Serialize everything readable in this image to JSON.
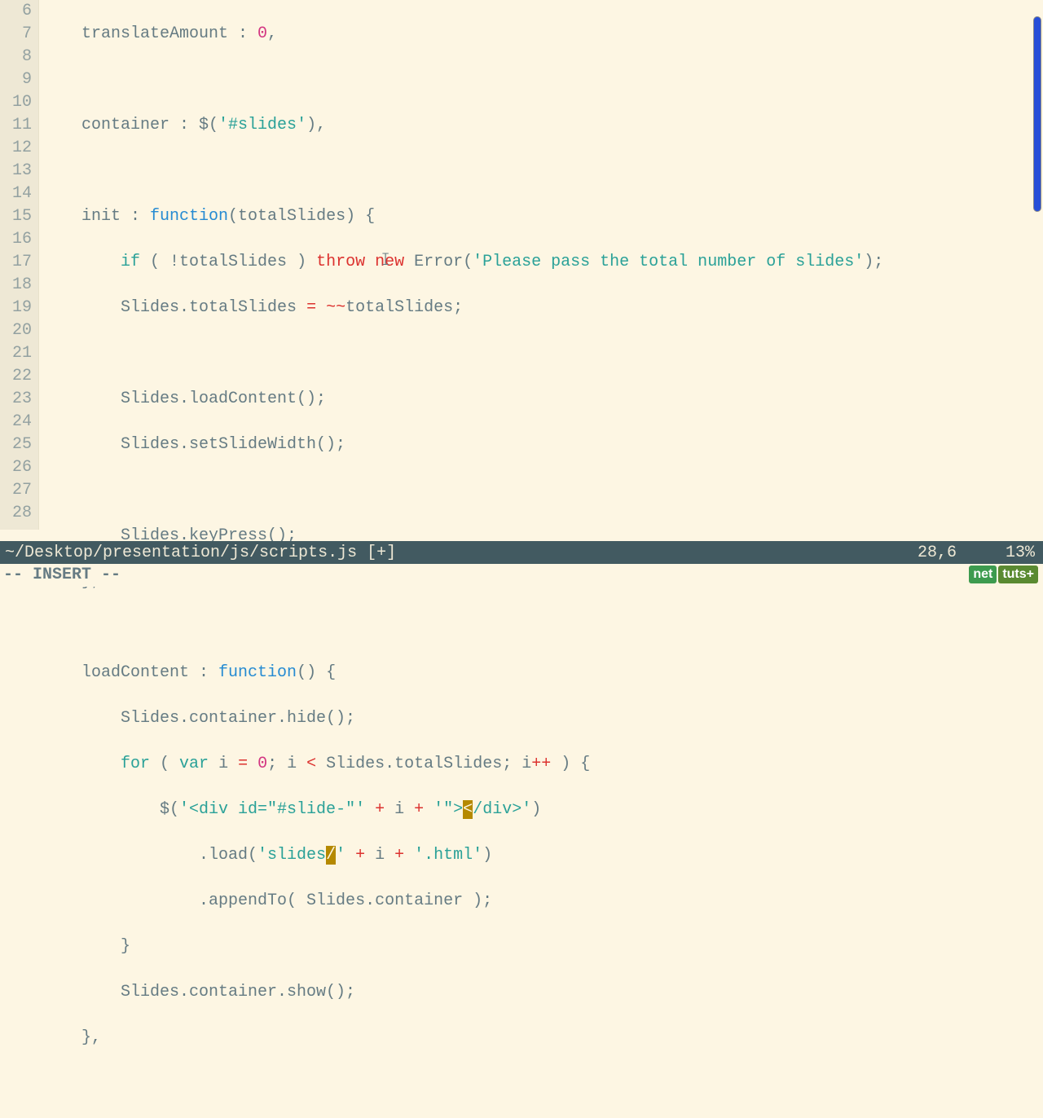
{
  "gutter": [
    "6",
    "7",
    "8",
    "9",
    "10",
    "11",
    "12",
    "13",
    "14",
    "15",
    "16",
    "17",
    "18",
    "19",
    "20",
    "21",
    "22",
    "23",
    "24",
    "25",
    "26",
    "27",
    "28"
  ],
  "code": {
    "l6a": "    translateAmount : ",
    "l6b": "0",
    "l6c": ",",
    "l7": "",
    "l8a": "    container : $(",
    "l8b": "'#slides'",
    "l8c": "),",
    "l9": "",
    "l10a": "    init : ",
    "l10b": "function",
    "l10c": "(totalSlides) {",
    "l11a": "        ",
    "l11b": "if",
    "l11c": " ( !totalSlides ) ",
    "l11d": "throw",
    "l11e": " ",
    "l11f": "new",
    "l11g": " Error(",
    "l11h": "'Please pass the total number of slides'",
    "l11i": ");",
    "l12a": "        Slides.totalSlides ",
    "l12b": "=",
    "l12c": " ",
    "l12d": "~~",
    "l12e": "totalSlides;",
    "l13": "",
    "l14": "        Slides.loadContent();",
    "l15": "        Slides.setSlideWidth();",
    "l16": "",
    "l17": "        Slides.keyPress();",
    "l18": "    },",
    "l19": "",
    "l20a": "    loadContent : ",
    "l20b": "function",
    "l20c": "() {",
    "l21": "        Slides.container.hide();",
    "l22a": "        ",
    "l22b": "for",
    "l22c": " ( ",
    "l22d": "var",
    "l22e": " i ",
    "l22f": "=",
    "l22g": " ",
    "l22h": "0",
    "l22i": "; i ",
    "l22j": "<",
    "l22k": " Slides.totalSlides; i",
    "l22l": "++",
    "l22m": " ) {",
    "l23a": "            $(",
    "l23b": "'<div id=\"#slide-\"'",
    "l23c": " ",
    "l23d": "+",
    "l23e": " i ",
    "l23f": "+",
    "l23g": " ",
    "l23h": "'\">",
    "l23i": "<",
    "l23j": "/",
    "l23k": "div>'",
    "l23l": ")",
    "l24a": "                .load(",
    "l24b": "'slides",
    "l24c": "/",
    "l24d": "'",
    "l24e": " ",
    "l24f": "+",
    "l24g": " i ",
    "l24h": "+",
    "l24i": " ",
    "l24j": "'.html'",
    "l24k": ")",
    "l25": "                .appendTo( Slides.container );",
    "l26": "        }",
    "l27": "        Slides.container.show();",
    "l28": "    },"
  },
  "cursor_caret": "ꕯ",
  "statusbar": {
    "file": "~/Desktop/presentation/js/scripts.js [+]",
    "pos": "28,6",
    "pct": "13%"
  },
  "modeline": "-- INSERT --",
  "logo": {
    "net": "net",
    "tuts": "tuts+"
  }
}
